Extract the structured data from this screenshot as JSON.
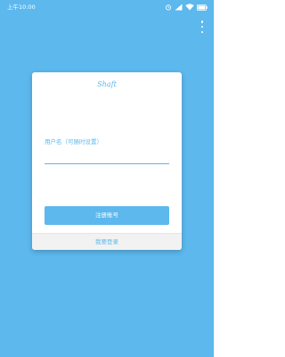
{
  "status_bar": {
    "time": "上午10:00",
    "icons": [
      "alarm-icon",
      "signal-icon",
      "wifi-icon",
      "battery-icon"
    ]
  },
  "menu": {
    "icon": "more-vertical-icon"
  },
  "card": {
    "title": "Shaft",
    "username_label": "用户名（可随时设置）",
    "username_value": "",
    "register_button": "注册账号",
    "login_link": "我要登录"
  },
  "colors": {
    "background": "#5cb8ed",
    "accent": "#5cb8ed",
    "card": "#ffffff",
    "footer": "#f2f2f2"
  }
}
